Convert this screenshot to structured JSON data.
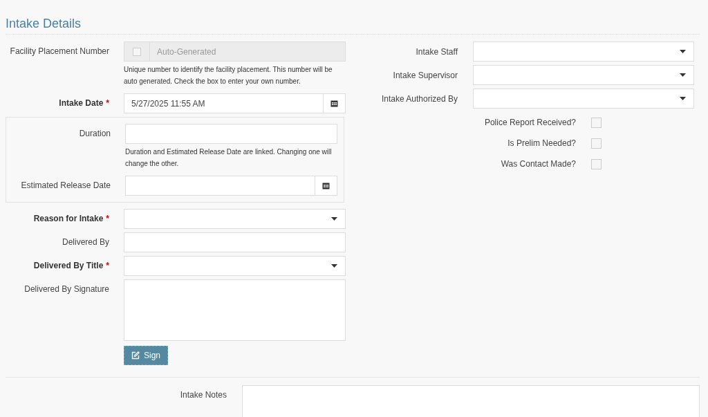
{
  "section_title": "Intake Details",
  "required_marker": "*",
  "left_fields": [
    {
      "kind": "autonumber",
      "label": "Facility Placement Number",
      "required": false,
      "checked": false,
      "value": "Auto-Generated",
      "help": "Unique number to identify the facility placement. This number will be auto generated. Check the box to enter your own number."
    },
    {
      "kind": "date",
      "label": "Intake Date",
      "required": true,
      "value": "5/27/2025 11:55 AM"
    },
    {
      "kind": "group",
      "help": "Duration and Estimated Release Date are linked. Changing one will change the other.",
      "children": [
        {
          "kind": "text",
          "label": "Duration",
          "required": false
        },
        {
          "kind": "date",
          "label": "Estimated Release Date",
          "required": false
        }
      ]
    },
    {
      "kind": "select",
      "label": "Reason for Intake",
      "required": true
    },
    {
      "kind": "text",
      "label": "Delivered By",
      "required": false
    },
    {
      "kind": "select",
      "label": "Delivered By Title",
      "required": true
    },
    {
      "kind": "signature",
      "label": "Delivered By Signature",
      "required": false,
      "button": "Sign"
    }
  ],
  "right_fields": [
    {
      "kind": "select",
      "label": "Intake Staff"
    },
    {
      "kind": "select",
      "label": "Intake Supervisor"
    },
    {
      "kind": "select",
      "label": "Intake Authorized By"
    },
    {
      "kind": "checkbox",
      "label": "Police Report Received?",
      "checked": false
    },
    {
      "kind": "checkbox",
      "label": "Is Prelim Needed?",
      "checked": false
    },
    {
      "kind": "checkbox",
      "label": "Was Contact Made?",
      "checked": false
    }
  ],
  "notes": {
    "label": "Intake Notes"
  }
}
